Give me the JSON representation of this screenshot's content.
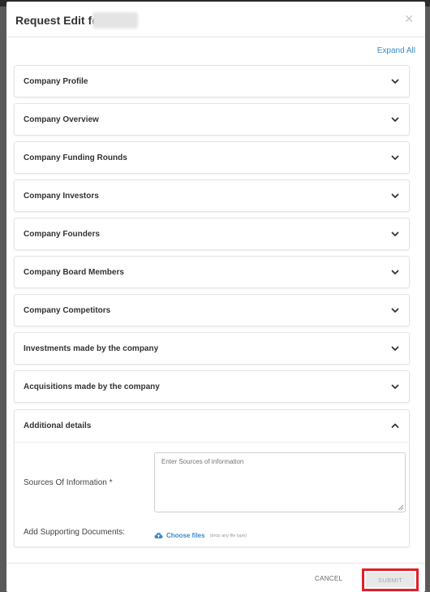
{
  "modal": {
    "title": "Request Edit for",
    "close_icon": "close-icon",
    "expand_all": "Expand All"
  },
  "panels": [
    {
      "label": "Company Profile",
      "icon": "chevron-down-icon"
    },
    {
      "label": "Company Overview",
      "icon": "chevron-down-icon"
    },
    {
      "label": "Company Funding Rounds",
      "icon": "chevron-down-icon"
    },
    {
      "label": "Company Investors",
      "icon": "chevron-down-icon"
    },
    {
      "label": "Company Founders",
      "icon": "chevron-down-icon"
    },
    {
      "label": "Company Board Members",
      "icon": "chevron-down-icon"
    },
    {
      "label": "Company Competitors",
      "icon": "chevron-down-icon"
    },
    {
      "label": "Investments made by the company",
      "icon": "chevron-down-icon"
    },
    {
      "label": "Acquisitions made by the company",
      "icon": "chevron-down-icon"
    }
  ],
  "additional": {
    "label": "Additional details",
    "icon": "chevron-up-icon",
    "sources_label": "Sources Of Information *",
    "sources_placeholder": "Enter Sources of information",
    "docs_label": "Add Supporting Documents:",
    "choose_files": "Choose files",
    "choose_hint": "(drop any file type)",
    "upload_icon": "cloud-upload-icon"
  },
  "footer": {
    "cancel": "CANCEL",
    "submit": "SUBMIT",
    "highlight_color": "#e0202a"
  },
  "colors": {
    "accent": "#3a8cc8"
  }
}
